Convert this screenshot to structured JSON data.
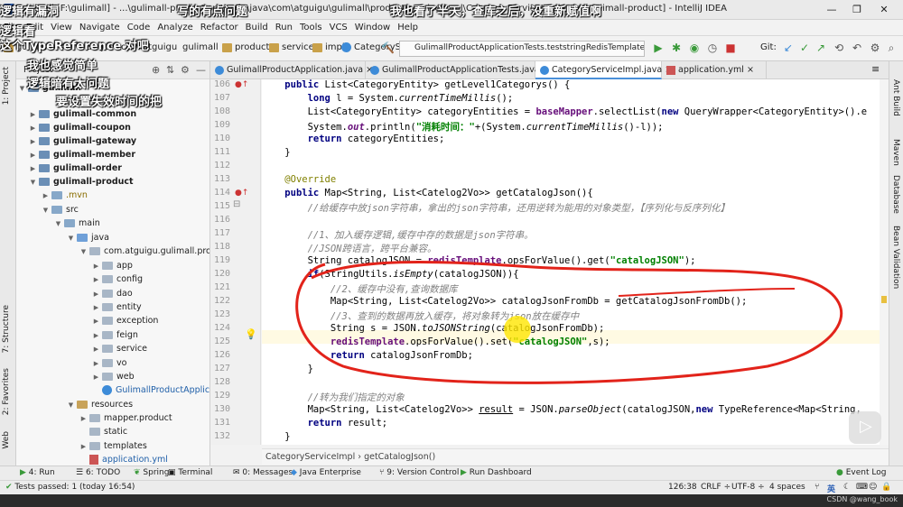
{
  "window": {
    "title": "gulimall [F:\\gulimall] - ...\\gulimall-product\\src\\main\\java\\com\\atguigu\\gulimall\\product\\service\\impl\\CategoryServiceImpl.java [gulimall-product] - IntelliJ IDEA",
    "min": "—",
    "max": "❐",
    "close": "✕"
  },
  "menu": [
    "File",
    "Edit",
    "View",
    "Navigate",
    "Code",
    "Analyze",
    "Refactor",
    "Build",
    "Run",
    "Tools",
    "VCS",
    "Window",
    "Help"
  ],
  "nav": {
    "crumbs": [
      "gulimall",
      "src",
      "main",
      "java",
      "com",
      "atguigu",
      "gulimall",
      "product",
      "service",
      "impl"
    ],
    "current_class": "CategoryServiceImpl",
    "run_config": "GulimallProductApplicationTests.teststringRedisTemplate",
    "git_label": "Git:"
  },
  "project": {
    "header": "Project",
    "tree": [
      {
        "label": "gulimall",
        "kind": "mod",
        "bold": true
      },
      {
        "label": "gulimall-common",
        "kind": "mod",
        "bold": true
      },
      {
        "label": "gulimall-coupon",
        "kind": "mod",
        "bold": true
      },
      {
        "label": "gulimall-gateway",
        "kind": "mod",
        "bold": true
      },
      {
        "label": "gulimall-member",
        "kind": "mod",
        "bold": true
      },
      {
        "label": "gulimall-order",
        "kind": "mod",
        "bold": true
      },
      {
        "label": "gulimall-product",
        "kind": "mod",
        "bold": true
      },
      {
        "label": ".mvn",
        "kind": "fold"
      },
      {
        "label": "src",
        "kind": "fold"
      },
      {
        "label": "main",
        "kind": "fold"
      },
      {
        "label": "java",
        "kind": "src"
      },
      {
        "label": "com.atguigu.gulimall.produ",
        "kind": "pkg"
      },
      {
        "label": "app",
        "kind": "pkg"
      },
      {
        "label": "config",
        "kind": "pkg"
      },
      {
        "label": "dao",
        "kind": "pkg"
      },
      {
        "label": "entity",
        "kind": "pkg"
      },
      {
        "label": "exception",
        "kind": "pkg"
      },
      {
        "label": "feign",
        "kind": "pkg"
      },
      {
        "label": "service",
        "kind": "pkg"
      },
      {
        "label": "vo",
        "kind": "pkg"
      },
      {
        "label": "web",
        "kind": "pkg"
      },
      {
        "label": "GulimallProductApplicati",
        "kind": "cls"
      },
      {
        "label": "resources",
        "kind": "res"
      },
      {
        "label": "mapper.product",
        "kind": "pkg"
      },
      {
        "label": "static",
        "kind": "pkg"
      },
      {
        "label": "templates",
        "kind": "pkg"
      },
      {
        "label": "application.yml",
        "kind": "yml"
      }
    ]
  },
  "tabs": [
    {
      "label": "GulimallProductApplication.java"
    },
    {
      "label": "GulimallProductApplicationTests.java"
    },
    {
      "label": "CategoryServiceImpl.java"
    },
    {
      "label": "application.yml"
    }
  ],
  "line_numbers": [
    "106",
    "107",
    "108",
    "109",
    "110",
    "111",
    "112",
    "113",
    "114",
    "115",
    "116",
    "117",
    "118",
    "119",
    "120",
    "121",
    "122",
    "123",
    "124",
    "125",
    "126",
    "127",
    "128",
    "129",
    "130",
    "131",
    "132",
    "133"
  ],
  "code": {
    "l106a": "    ",
    "l106k": "public",
    "l106b": " List<CategoryEntity> getLevel1Categorys() {",
    "l107a": "        ",
    "l107k": "long",
    "l107b": " l = System.",
    "l107i": "currentTimeMillis",
    "l107c": "();",
    "l108a": "        List<CategoryEntity> categoryEntities = ",
    "l108f": "baseMapper",
    "l108b": ".selectList(",
    "l108k": "new",
    "l108c": " QueryWrapper<CategoryEntity>().e",
    "l109a": "        System.",
    "l109f": "out",
    "l109b": ".println(",
    "l109s": "\"消耗时间：\"",
    "l109c": "+(System.",
    "l109i": "currentTimeMillis",
    "l109d": "()-l));",
    "l110a": "        ",
    "l110k": "return",
    "l110b": " categoryEntities;",
    "l111": "    }",
    "l112": "",
    "l113a": "    ",
    "l113n": "@Override",
    "l114a": "    ",
    "l114k": "public",
    "l114b": " Map<String, List<Catelog2Vo>> getCatalogJson(){",
    "l115a": "        ",
    "l115c": "//给缓存中放json字符串，拿出的json字符串，还用逆转为能用的对象类型，【序列化与反序列化】",
    "l116": "",
    "l117a": "        ",
    "l117c": "//1、加入缓存逻辑,缓存中存的数据是json字符串。",
    "l118a": "        ",
    "l118c": "//JSON跨语言，跨平台兼容。",
    "l119a": "        String catalogJSON = ",
    "l119f": "redisTemplate",
    "l119b": ".opsForValue().get(",
    "l119s": "\"catalogJSON\"",
    "l119c": ");",
    "l120a": "        ",
    "l120k": "if",
    "l120b": "(StringUtils.",
    "l120i": "isEmpty",
    "l120c": "(catalogJSON)){",
    "l121a": "            ",
    "l121c": "//2、缓存中没有,查询数据库",
    "l122": "            Map<String, List<Catelog2Vo>> catalogJsonFromDb = getCatalogJsonFromDb();",
    "l123a": "            ",
    "l123c": "//3、查到的数据再放入缓存，将对象转为json放在缓存中",
    "l124a": "            String s = JSON.",
    "l124i": "toJSONString",
    "l124b": "(catalogJsonFromDb);",
    "l125a": "            ",
    "l125f": "redisTemplate",
    "l125b": ".opsForValue().set(",
    "l125s": "\"catalogJSON\"",
    "l125c": ",s);",
    "l126a": "            ",
    "l126k": "return",
    "l126b": " catalogJsonFromDb;",
    "l127": "        }",
    "l128": "",
    "l129a": "        ",
    "l129c": "//转为我们指定的对象",
    "l130a": "        Map<String, List<Catelog2Vo>> ",
    "l130v": "result",
    "l130b": " = JSON.",
    "l130i": "parseObject",
    "l130c": "(catalogJSON,",
    "l130k": "new",
    "l130d": " TypeReference<Map<String,",
    "l131a": "        ",
    "l131k": "return",
    "l131b": " result;",
    "l132": "    }",
    "l133": ""
  },
  "editor_crumb": "CategoryServiceImpl  ›  getCatalogJson()",
  "right_tabs": [
    "Ant Build",
    "Maven",
    "Database",
    "Bean Validation"
  ],
  "left_tabs": [
    "1: Project",
    "7: Structure",
    "2: Favorites",
    "Web"
  ],
  "bottom_tools": [
    "4: Run",
    "6: TODO",
    "Spring",
    "Terminal",
    "0: Messages",
    "Java Enterprise",
    "9: Version Control",
    "Run Dashboard",
    "Event Log"
  ],
  "status": {
    "left": "Tests passed: 1 (today 16:54)",
    "pos": "126:38",
    "crlf": "CRLF ÷",
    "enc": "UTF-8 ÷",
    "indent": "4 spaces",
    "ime": "英"
  },
  "overlay": {
    "subs": [
      "逻辑有漏洞",
      "写的有点问题",
      "我也看了半天，查库之后，没重新赋值啊",
      "这个TypeReference 对吧",
      "逻辑看",
      "我也感觉简单",
      "逻辑暗有太问题",
      "要设置失效时间的把"
    ],
    "watermark": "CSDN @wang_book"
  }
}
